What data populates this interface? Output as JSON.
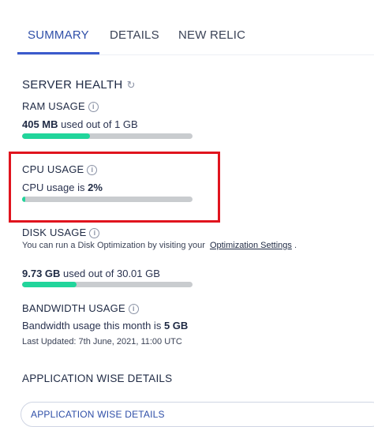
{
  "tabs": [
    {
      "label": "SUMMARY",
      "active": true
    },
    {
      "label": "DETAILS",
      "active": false
    },
    {
      "label": "NEW RELIC",
      "active": false
    }
  ],
  "server_health": {
    "title": "SERVER HEALTH",
    "ram": {
      "label": "RAM USAGE",
      "value": "405 MB",
      "suffix": "used out of 1 GB",
      "percent": 40
    },
    "cpu": {
      "label": "CPU USAGE",
      "prefix": "CPU usage is",
      "value": "2%",
      "percent": 2
    },
    "disk": {
      "label": "DISK USAGE",
      "note": "You can run a Disk Optimization by visiting your",
      "link": "Optimization Settings",
      "note_end": ".",
      "value": "9.73 GB",
      "suffix": "used out of 30.01 GB",
      "percent": 32
    },
    "bandwidth": {
      "label": "BANDWIDTH USAGE",
      "prefix": "Bandwidth usage this month is",
      "value": "5 GB",
      "updated": "Last Updated: 7th June, 2021, 11:00 UTC"
    }
  },
  "application": {
    "title": "APPLICATION WISE DETAILS",
    "button_label": "APPLICATION WISE DETAILS"
  },
  "colors": {
    "accent": "#3b5bcc",
    "bar_fill": "#21d59b",
    "bar_track": "#c9cccf",
    "highlight": "#e0141e"
  }
}
